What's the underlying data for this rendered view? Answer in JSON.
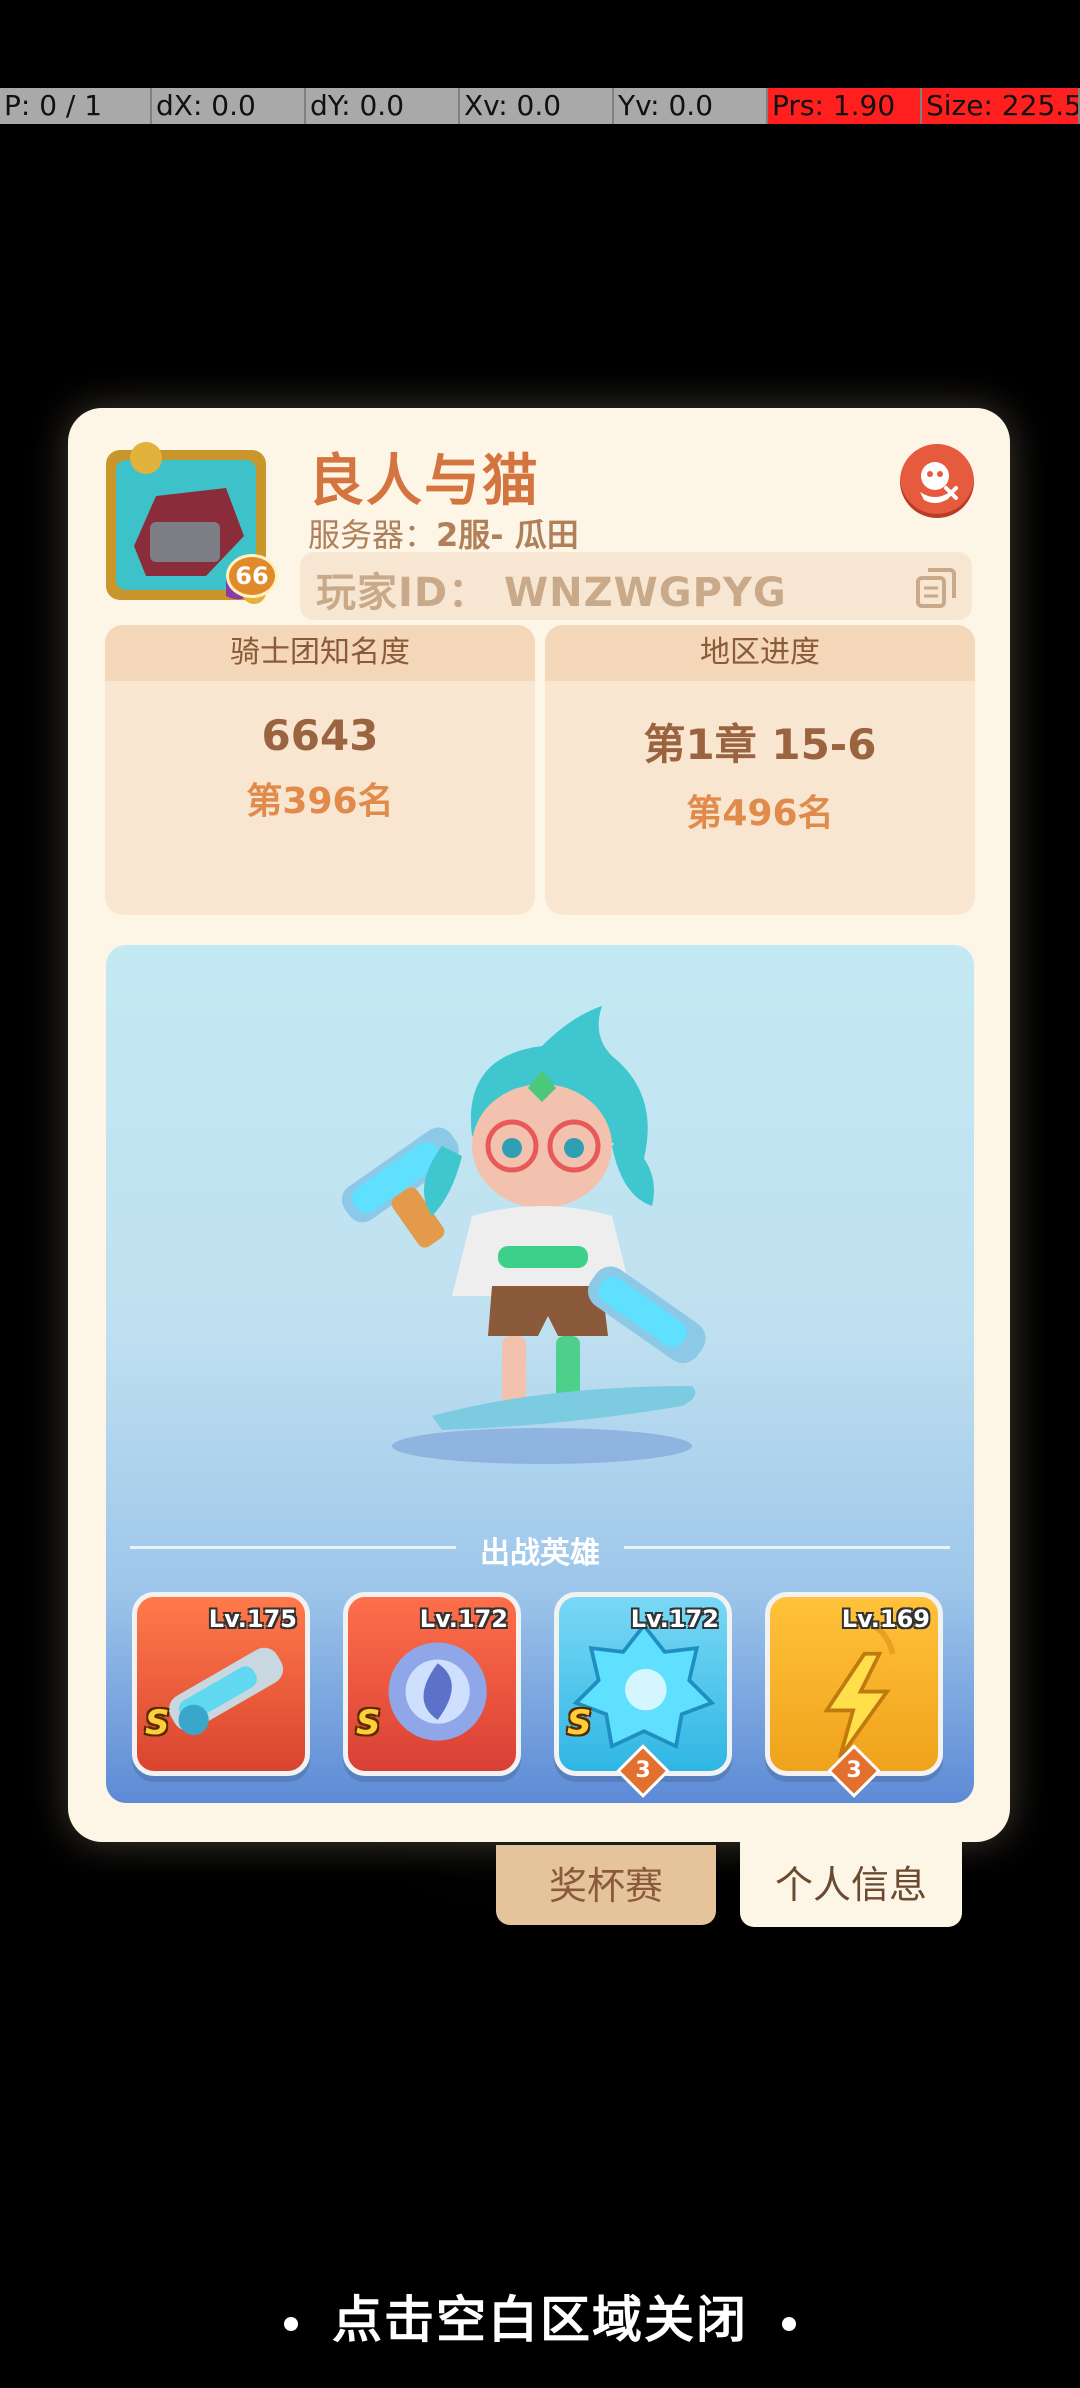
{
  "debug": {
    "pointer": "P: 0 / 1",
    "dx": "dX: 0.0",
    "dy": "dY: 0.0",
    "xv": "Xv: 0.0",
    "yv": "Yv: 0.0",
    "prs": "Prs: 1.90",
    "size": "Size: 225.50"
  },
  "profile": {
    "level": "66",
    "name": "良人与猫",
    "server_label": "服务器：",
    "server_value": "2服- 瓜田",
    "player_id": "玩家ID：  WNZWGPYG"
  },
  "stats": {
    "left": {
      "title": "骑士团知名度",
      "value": "6643",
      "rank": "第396名"
    },
    "right": {
      "title": "地区进度",
      "value": "第1章 15-6",
      "rank": "第496名"
    }
  },
  "heroes_section": {
    "title": "出战英雄",
    "heroes": [
      {
        "level": "Lv.175",
        "grade": "S",
        "rank": "",
        "color": "#e8533a"
      },
      {
        "level": "Lv.172",
        "grade": "S",
        "rank": "",
        "color": "#e0503c"
      },
      {
        "level": "Lv.172",
        "grade": "S",
        "rank": "3",
        "color": "#2fb6e4"
      },
      {
        "level": "Lv.169",
        "grade": "",
        "rank": "3",
        "color": "#f0a21c"
      }
    ]
  },
  "tabs": {
    "trophy": "奖杯赛",
    "profile": "个人信息"
  },
  "footer": {
    "hint": "点击空白区域关闭"
  },
  "colors": {
    "accent": "#d4753f",
    "card_bg": "#fdf5e6",
    "close": "#e65a3e"
  }
}
